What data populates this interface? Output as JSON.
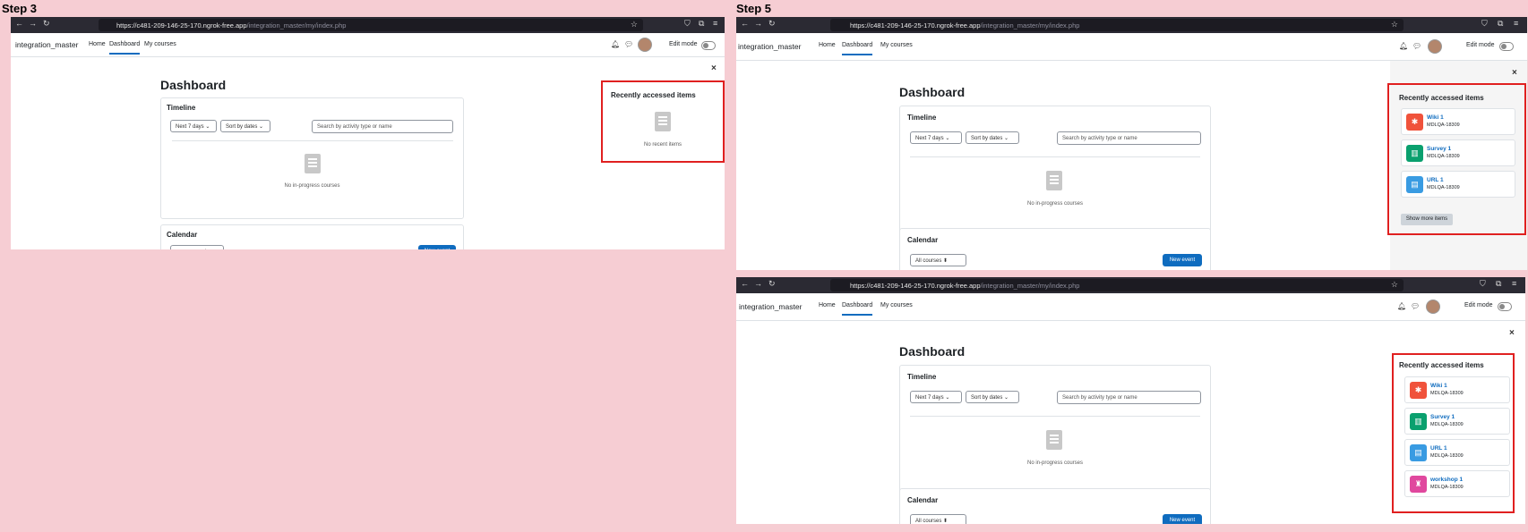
{
  "steps": [
    "Step 3",
    "Step 5"
  ],
  "browser": {
    "url_host": "https://c481-209-146-25-170.ngrok-free.app",
    "url_path": "/integration_master/my/index.php"
  },
  "site": {
    "brand": "integration_master",
    "nav": [
      "Home",
      "Dashboard",
      "My courses"
    ],
    "edit_mode": "Edit mode"
  },
  "page": {
    "title": "Dashboard",
    "timeline": {
      "title": "Timeline",
      "filter": "Next 7 days",
      "sort": "Sort by dates",
      "search_placeholder": "Search by activity type or name",
      "empty": "No in-progress courses"
    },
    "calendar": {
      "title": "Calendar",
      "courses_select": "All courses",
      "new_event": "New event"
    }
  },
  "recent_block": {
    "title": "Recently accessed items",
    "empty": "No recent items",
    "show_more": "Show more items",
    "items": [
      {
        "name": "Wiki 1",
        "course": "MDLQA-18309",
        "color": "#f0523b",
        "icon": "wiki-icon"
      },
      {
        "name": "Survey 1",
        "course": "MDLQA-18309",
        "color": "#0aa06e",
        "icon": "survey-icon"
      },
      {
        "name": "URL 1",
        "course": "MDLQA-18309",
        "color": "#399be2",
        "icon": "url-icon"
      },
      {
        "name": "workshop 1",
        "course": "MDLQA-18309",
        "color": "#e0489e",
        "icon": "workshop-icon"
      }
    ]
  },
  "colors": {
    "highlight": "#e02020",
    "primary": "#0f6cbf",
    "background": "#f6cdd3"
  }
}
